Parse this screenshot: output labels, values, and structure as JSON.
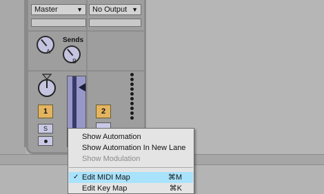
{
  "mixer": {
    "track1": {
      "output_select": "Master",
      "send_a_letter": "A",
      "send_b_letter": "B",
      "sends_label": "Sends",
      "track_number": "1",
      "solo_label": "S"
    },
    "track2": {
      "output_select": "No Output",
      "track_number": "2"
    }
  },
  "context_menu": {
    "items": [
      {
        "label": "Show Automation",
        "enabled": true
      },
      {
        "label": "Show Automation In New Lane",
        "enabled": true
      },
      {
        "label": "Show Modulation",
        "enabled": false
      },
      {
        "label": "Edit MIDI Map",
        "shortcut": "⌘M",
        "checked": true,
        "highlighted": true
      },
      {
        "label": "Edit Key Map",
        "shortcut": "⌘K"
      }
    ],
    "check_glyph": "✓"
  },
  "colors": {
    "background": "#b6b6b6",
    "track_number_button": "#e3b460",
    "knob_fill": "#c4c4e0",
    "menu_highlight": "#a9e2fb",
    "menu_background": "#e4e4e4"
  }
}
